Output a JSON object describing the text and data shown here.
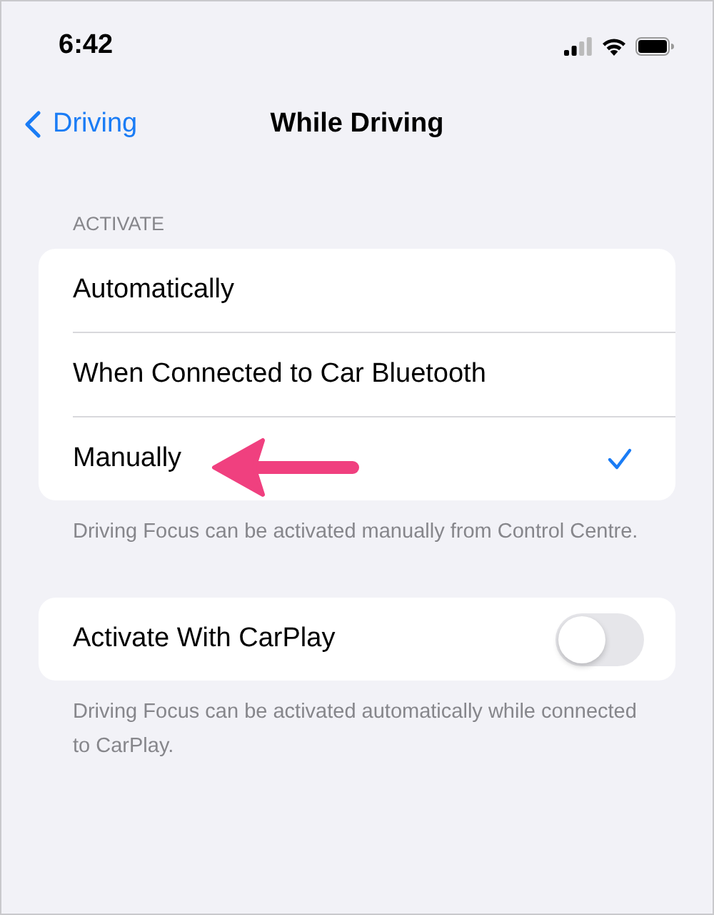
{
  "status_bar": {
    "time": "6:42"
  },
  "nav": {
    "back_label": "Driving",
    "title": "While Driving"
  },
  "sections": [
    {
      "header": "ACTIVATE",
      "rows": [
        {
          "kind": "choice",
          "label": "Automatically",
          "selected": false
        },
        {
          "kind": "choice",
          "label": "When Connected to Car Bluetooth",
          "selected": false
        },
        {
          "kind": "choice",
          "label": "Manually",
          "selected": true
        }
      ],
      "footer": "Driving Focus can be activated manually from Control Centre."
    },
    {
      "rows": [
        {
          "kind": "toggle",
          "label": "Activate With CarPlay",
          "on": false
        }
      ],
      "footer": "Driving Focus can be activated automatically while connected to CarPlay."
    }
  ]
}
